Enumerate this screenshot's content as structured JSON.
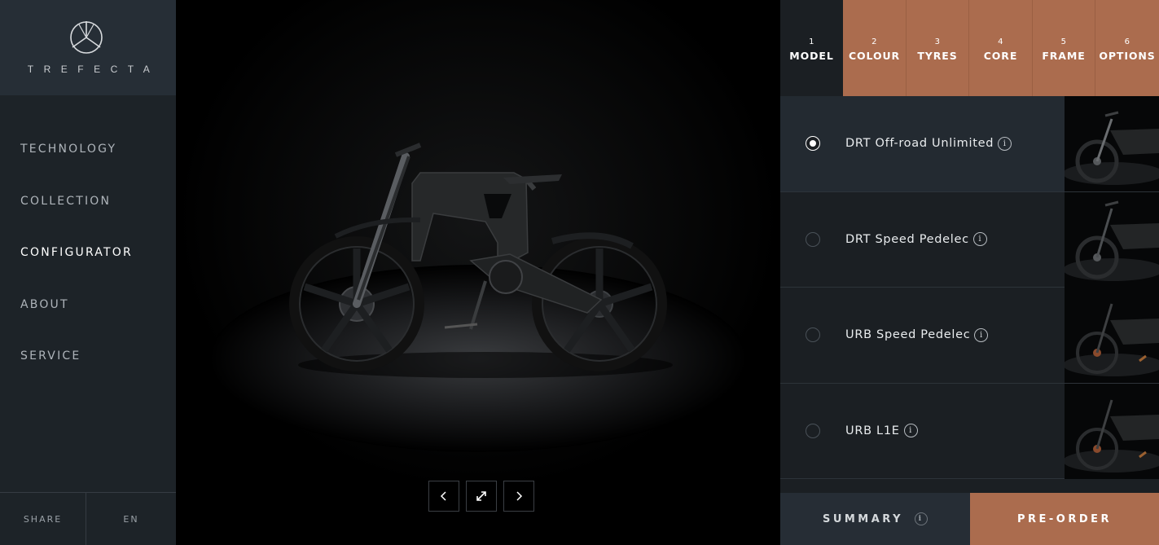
{
  "brand": {
    "name": "TREFECTA",
    "logo_icon": "trefecta-tripod-icon"
  },
  "nav": {
    "items": [
      {
        "label": "TECHNOLOGY",
        "active": false
      },
      {
        "label": "COLLECTION",
        "active": false
      },
      {
        "label": "CONFIGURATOR",
        "active": true
      },
      {
        "label": "ABOUT",
        "active": false
      },
      {
        "label": "SERVICE",
        "active": false
      }
    ]
  },
  "footer": {
    "share_label": "SHARE",
    "language_label": "EN"
  },
  "viewer": {
    "prev_icon": "chevron-left-icon",
    "fullscreen_icon": "expand-icon",
    "next_icon": "chevron-right-icon"
  },
  "steps": [
    {
      "num": "1",
      "label": "MODEL",
      "current": true
    },
    {
      "num": "2",
      "label": "COLOUR",
      "current": false
    },
    {
      "num": "3",
      "label": "TYRES",
      "current": false
    },
    {
      "num": "4",
      "label": "CORE",
      "current": false
    },
    {
      "num": "5",
      "label": "FRAME",
      "current": false
    },
    {
      "num": "6",
      "label": "OPTIONS",
      "current": false
    }
  ],
  "models": [
    {
      "name": "DRT Off-road Unlimited",
      "selected": true,
      "info": "i"
    },
    {
      "name": "DRT Speed Pedelec",
      "selected": false,
      "info": "i"
    },
    {
      "name": "URB Speed Pedelec",
      "selected": false,
      "info": "i"
    },
    {
      "name": "URB L1E",
      "selected": false,
      "info": "i"
    }
  ],
  "actions": {
    "summary_label": "SUMMARY",
    "summary_info": "i",
    "preorder_label": "PRE-ORDER"
  },
  "colors": {
    "accent": "#ab6c4e",
    "sidebar": "#1d2328",
    "panel": "#1b1f23"
  }
}
